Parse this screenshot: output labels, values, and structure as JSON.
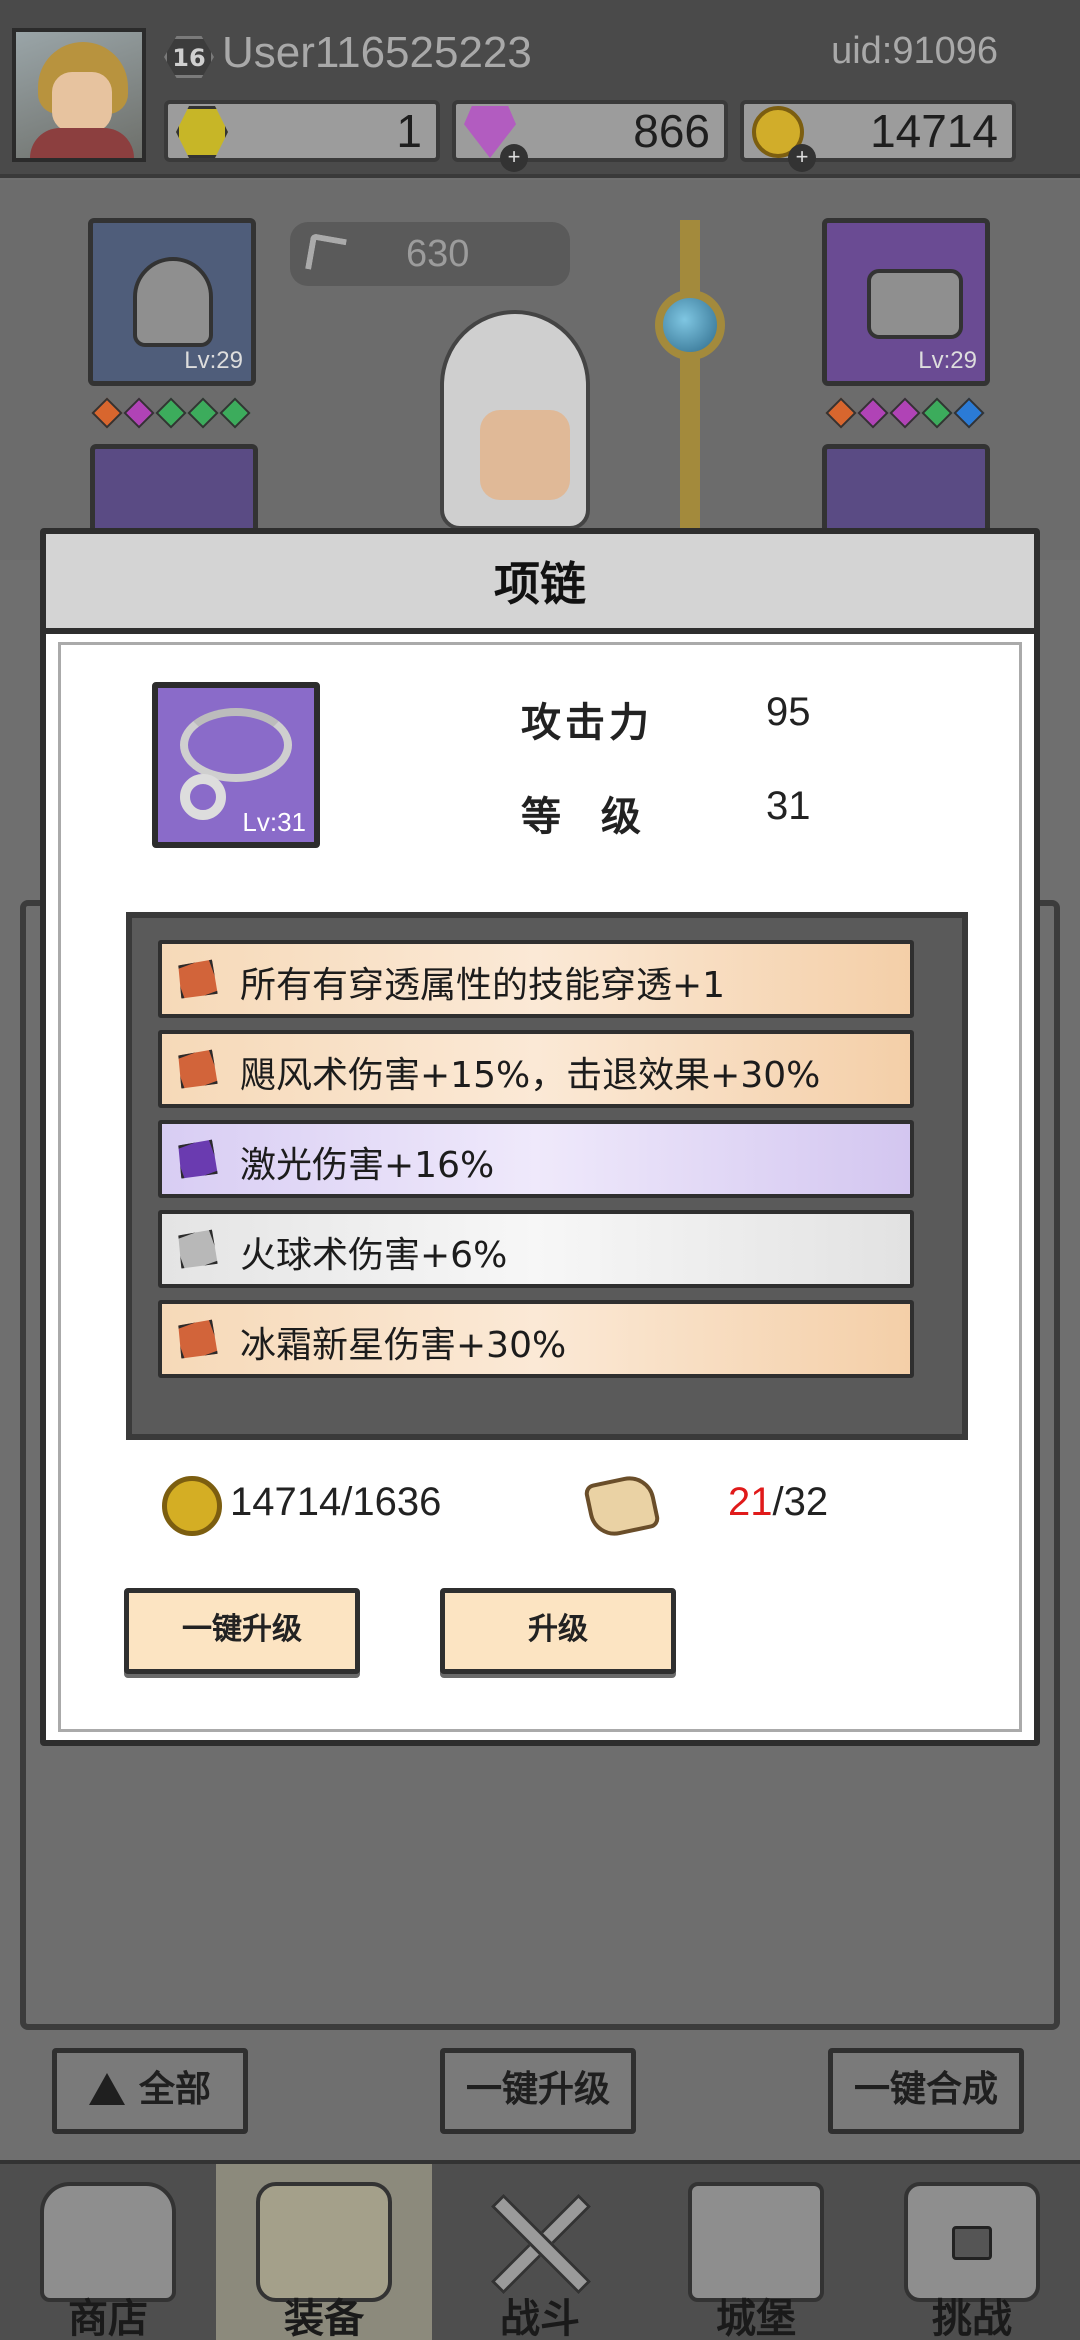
{
  "header": {
    "level": "16",
    "username": "User116525223",
    "uid": "uid:91096",
    "resources": {
      "energy": "1",
      "gems": "866",
      "gold": "14714"
    }
  },
  "equipment": {
    "power": "630",
    "slot_left_lv": "Lv:29",
    "slot_right_lv": "Lv:29",
    "gems_left": [
      "#d8662e",
      "#b043b6",
      "#3cac5c",
      "#3cac5c",
      "#3cac5c"
    ],
    "gems_right": [
      "#d8662e",
      "#b043b6",
      "#b043b6",
      "#3cac5c",
      "#2b7bd6"
    ]
  },
  "modal": {
    "title": "项链",
    "item_lv": "Lv:31",
    "stats": [
      {
        "label": "攻击力",
        "value": "95"
      },
      {
        "label": "等  级",
        "value": "31"
      }
    ],
    "affixes": [
      {
        "text": "所有有穿透属性的技能穿透+1",
        "tier": "orange"
      },
      {
        "text": "飓风术伤害+15%，击退效果+30%",
        "tier": "orange"
      },
      {
        "text": "激光伤害+16%",
        "tier": "purple"
      },
      {
        "text": "火球术伤害+6%",
        "tier": "white"
      },
      {
        "text": "冰霜新星伤害+30%",
        "tier": "orange"
      }
    ],
    "cost_gold": "14714/1636",
    "cost_scroll_have": "21",
    "cost_scroll_need": "/32",
    "btn_upgrade_all": "一键升级",
    "btn_upgrade": "升级"
  },
  "actions": {
    "all": "全部",
    "upgrade_all": "一键升级",
    "merge_all": "一键合成"
  },
  "nav": [
    {
      "label": "商店"
    },
    {
      "label": "装备"
    },
    {
      "label": "战斗"
    },
    {
      "label": "城堡"
    },
    {
      "label": "挑战"
    }
  ]
}
